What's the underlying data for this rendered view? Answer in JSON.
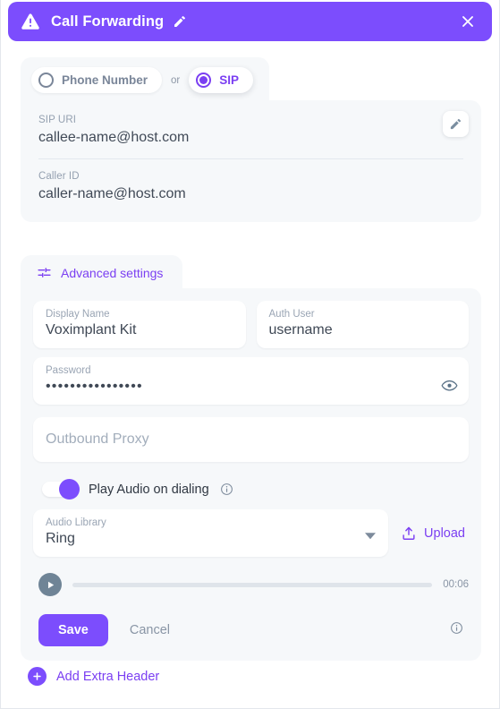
{
  "titlebar": {
    "title": "Call Forwarding",
    "warning_icon": "warning-triangle-icon",
    "edit_icon": "pencil-icon",
    "close_icon": "close-icon"
  },
  "destination": {
    "options": [
      {
        "label": "Phone Number",
        "selected": false
      },
      {
        "label": "SIP",
        "selected": true
      }
    ],
    "separator": "or",
    "edit_icon": "pencil-icon",
    "fields": [
      {
        "label": "SIP URI",
        "value": "callee-name@host.com"
      },
      {
        "label": "Caller ID",
        "value": "caller-name@host.com"
      }
    ]
  },
  "advanced": {
    "tab_label": "Advanced settings",
    "tab_icon": "tune-sliders-icon",
    "display_name": {
      "label": "Display Name",
      "value": "Voximplant Kit"
    },
    "auth_user": {
      "label": "Auth User",
      "value": "username"
    },
    "password": {
      "label": "Password",
      "value": "••••••••••••••••",
      "toggle_icon": "eye-icon"
    },
    "outbound_proxy": {
      "placeholder": "Outbound Proxy",
      "value": ""
    },
    "play_audio": {
      "label": "Play Audio on dialing",
      "enabled": true,
      "info_icon": "info-circle-icon"
    },
    "audio_library": {
      "label": "Audio Library",
      "value": "Ring",
      "caret_icon": "chevron-down-icon"
    },
    "upload": {
      "label": "Upload",
      "icon": "upload-icon"
    },
    "player": {
      "play_icon": "play-icon",
      "duration": "00:06",
      "progress_percent": 0
    },
    "actions": {
      "save_label": "Save",
      "cancel_label": "Cancel",
      "info_icon": "info-circle-icon"
    }
  },
  "extra_header": {
    "label": "Add Extra Header",
    "icon": "plus-icon"
  },
  "colors": {
    "accent": "#7c4dfd",
    "accent_text": "#7b3ff2",
    "card_bg": "#f6f8fa",
    "label_gray": "#94a0b0"
  }
}
